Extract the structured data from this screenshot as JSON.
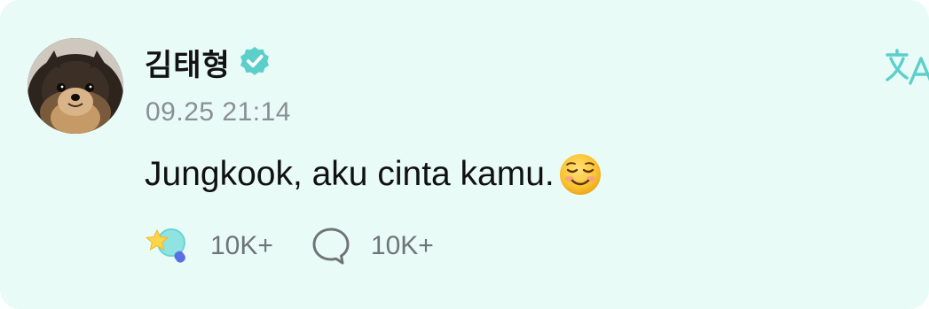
{
  "post": {
    "author": {
      "name": "김태형",
      "verified": true,
      "avatar_icon": "pomeranian-dog-avatar"
    },
    "timestamp": "09.25 21:14",
    "message": "Jungkook, aku cinta kamu.",
    "message_emoji": "smiling-face-emoji",
    "reactions": {
      "like_icon": "star-cheer-icon",
      "like_count": "10K+",
      "comment_icon": "comment-bubble-icon",
      "comment_count": "10K+"
    },
    "translate_icon": "translate-icon"
  },
  "colors": {
    "card_background": "#e8fbf7",
    "accent": "#5ccfca",
    "verified_badge": "#5ccfca",
    "timestamp_text": "#8a8f93",
    "count_text": "#6f7478"
  }
}
